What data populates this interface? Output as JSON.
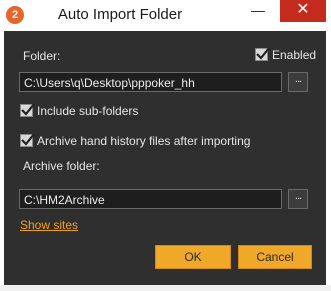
{
  "window": {
    "title": "Auto Import Folder",
    "app_icon_glyph": "2",
    "minimize_glyph": "—",
    "close_glyph": "✕"
  },
  "folder": {
    "label": "Folder:",
    "value": "C:\\Users\\q\\Desktop\\pppoker_hh",
    "browse_label": "..."
  },
  "enabled": {
    "label": "Enabled",
    "checked": true
  },
  "include_subfolders": {
    "label": "Include sub-folders",
    "checked": true
  },
  "archive_after_import": {
    "label": "Archive hand history files after importing",
    "checked": true
  },
  "archive_folder": {
    "label": "Archive folder:",
    "value": "C:\\HM2Archive",
    "browse_label": "..."
  },
  "show_sites_link": "Show sites",
  "buttons": {
    "ok": "OK",
    "cancel": "Cancel"
  },
  "colors": {
    "accent": "#f0a828",
    "background": "#2f2f2f",
    "close": "#c42b1c"
  }
}
